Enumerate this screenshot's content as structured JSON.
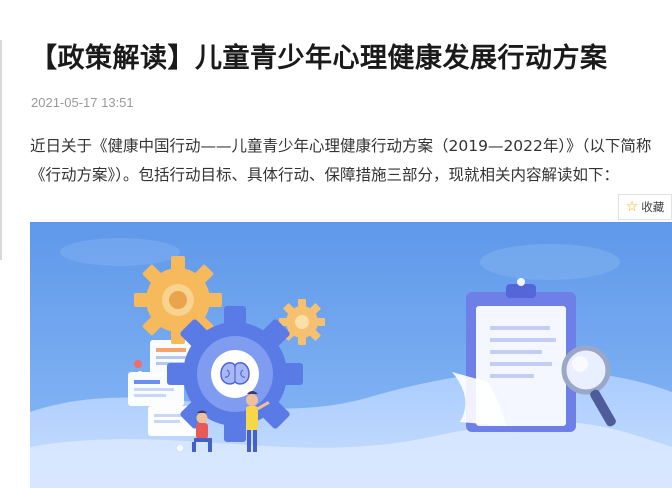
{
  "article": {
    "title": "【政策解读】儿童青少年心理健康发展行动方案",
    "date": "2021-05-17 13:51",
    "intro": "近日关于《健康中国行动——儿童青少年心理健康行动方案（2019—2022年）》（以下简称《行动方案》）。包括行动目标、具体行动、保障措施三部分，现就相关内容解读如下："
  },
  "favorite": {
    "label": "收藏",
    "icon": "star-outline-icon"
  },
  "hero_image": {
    "icons": [
      "gear-icon",
      "brain-icon",
      "clipboard-icon",
      "magnifier-icon"
    ],
    "colors": {
      "sky": "#6fa6ec",
      "wave": "#9bc4ff",
      "gear_orange": "#f6b95c",
      "gear_blue": "#5a7be6"
    }
  }
}
